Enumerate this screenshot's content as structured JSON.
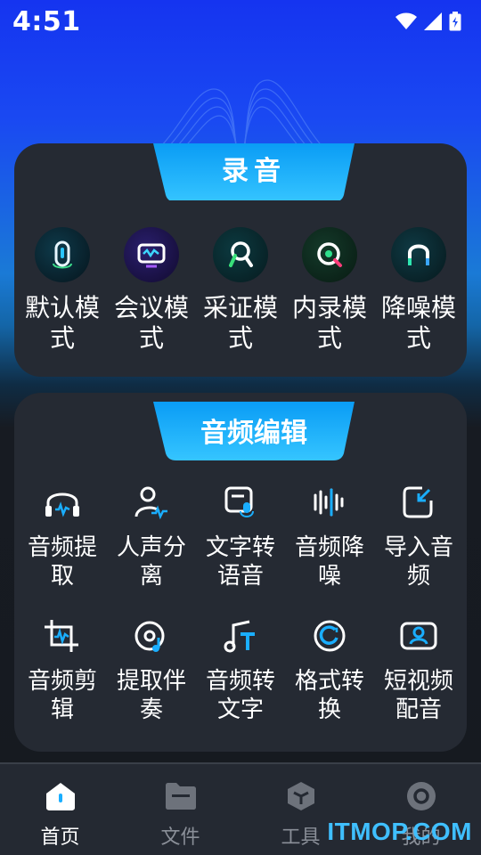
{
  "status_bar": {
    "time": "4:51"
  },
  "record_section": {
    "title": "录音",
    "modes": [
      {
        "label": "默认模式",
        "icon": "mic-capsule-icon"
      },
      {
        "label": "会议模式",
        "icon": "meeting-screen-icon"
      },
      {
        "label": "采证模式",
        "icon": "evidence-magnifier-icon"
      },
      {
        "label": "内录模式",
        "icon": "internal-record-icon"
      },
      {
        "label": "降噪模式",
        "icon": "noise-reduction-icon"
      }
    ]
  },
  "edit_section": {
    "title": "音频编辑",
    "rows": [
      [
        {
          "label": "音频提取",
          "icon": "headphones-wave-icon"
        },
        {
          "label": "人声分离",
          "icon": "person-wave-icon"
        },
        {
          "label": "文字转语音",
          "icon": "text-to-speech-icon"
        },
        {
          "label": "音频降噪",
          "icon": "sound-bars-icon"
        },
        {
          "label": "导入音频",
          "icon": "import-arrow-icon"
        }
      ],
      [
        {
          "label": "音频剪辑",
          "icon": "crop-wave-icon"
        },
        {
          "label": "提取伴奏",
          "icon": "disc-note-icon"
        },
        {
          "label": "音频转文字",
          "icon": "note-text-icon"
        },
        {
          "label": "格式转换",
          "icon": "convert-circle-icon"
        },
        {
          "label": "短视频配音",
          "icon": "video-person-icon"
        }
      ]
    ]
  },
  "bottom_nav": [
    {
      "label": "首页",
      "icon": "home-icon",
      "active": true
    },
    {
      "label": "文件",
      "icon": "folder-icon",
      "active": false
    },
    {
      "label": "工具",
      "icon": "toolbox-icon",
      "active": false
    },
    {
      "label": "我的",
      "icon": "profile-icon",
      "active": false
    }
  ],
  "watermark": "ITMOP.COM",
  "colors": {
    "accent": "#1aaeff",
    "accent_dark": "#0a7fe0",
    "card_bg": "#252a33",
    "nav_bg": "#242932",
    "nav_inactive": "#8a8f98"
  }
}
